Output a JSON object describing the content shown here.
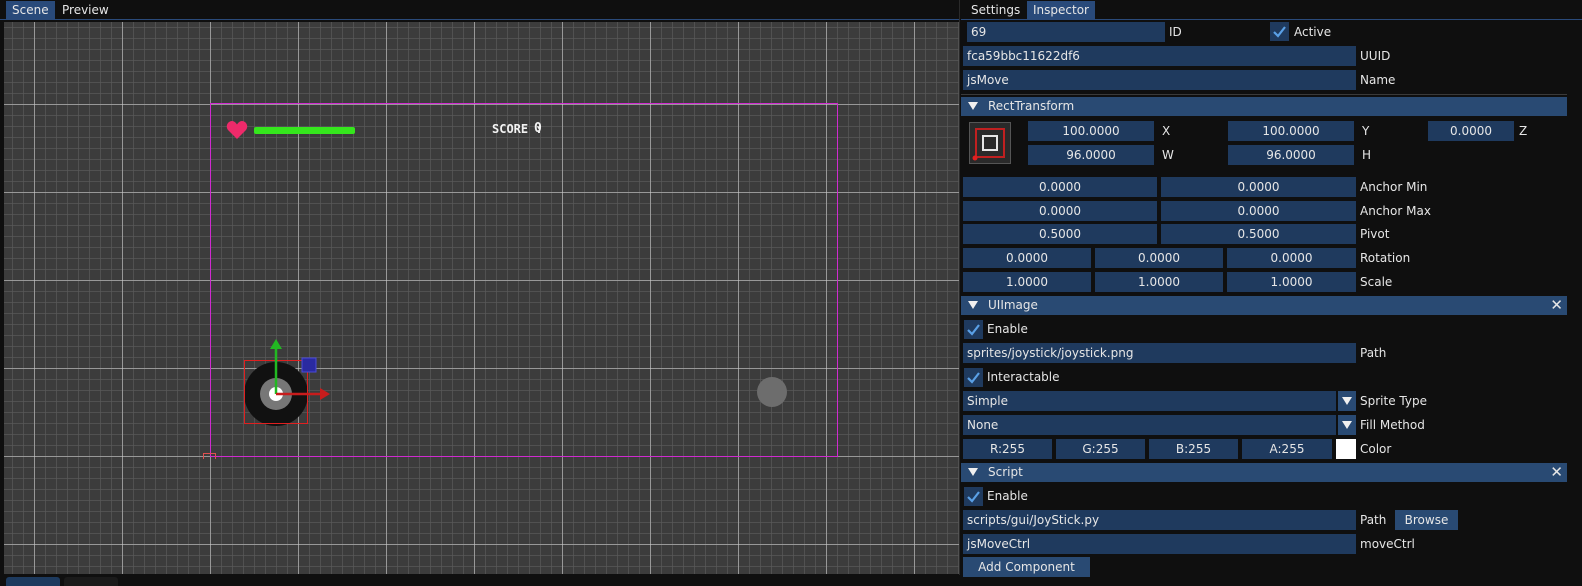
{
  "left": {
    "tabs": [
      {
        "label": "Scene",
        "active": true
      },
      {
        "label": "Preview",
        "active": false
      }
    ],
    "scene": {
      "score_label": "SCORE :",
      "score_value": "0",
      "colors": {
        "canvas_border": "#d02ad0",
        "health": "#35e61d",
        "heart": "#ee2a6a",
        "selection": "#e02020"
      }
    }
  },
  "right": {
    "tabs": [
      {
        "label": "Settings",
        "active": false
      },
      {
        "label": "Inspector",
        "active": true
      }
    ],
    "object": {
      "id_value": "69",
      "id_label": "ID",
      "active_label": "Active",
      "uuid_value": "fca59bbc11622df6",
      "uuid_label": "UUID",
      "name_value": "jsMove",
      "name_label": "Name"
    },
    "rect_transform": {
      "title": "RectTransform",
      "x": "100.0000",
      "x_label": "X",
      "y": "100.0000",
      "y_label": "Y",
      "z": "0.0000",
      "z_label": "Z",
      "w": "96.0000",
      "w_label": "W",
      "h": "96.0000",
      "h_label": "H",
      "anchor_min": [
        "0.0000",
        "0.0000"
      ],
      "anchor_min_label": "Anchor Min",
      "anchor_max": [
        "0.0000",
        "0.0000"
      ],
      "anchor_max_label": "Anchor Max",
      "pivot": [
        "0.5000",
        "0.5000"
      ],
      "pivot_label": "Pivot",
      "rotation": [
        "0.0000",
        "0.0000",
        "0.0000"
      ],
      "rotation_label": "Rotation",
      "scale": [
        "1.0000",
        "1.0000",
        "1.0000"
      ],
      "scale_label": "Scale"
    },
    "ui_image": {
      "title": "UIImage",
      "close": "✕",
      "enable_label": "Enable",
      "path_value": "sprites/joystick/joystick.png",
      "path_label": "Path",
      "interactable_label": "Interactable",
      "sprite_type_value": "Simple",
      "sprite_type_label": "Sprite Type",
      "fill_method_value": "None",
      "fill_method_label": "Fill Method",
      "color_r": "R:255",
      "color_g": "G:255",
      "color_b": "B:255",
      "color_a": "A:255",
      "color_label": "Color",
      "swatch_color": "#ffffff"
    },
    "script": {
      "title": "Script",
      "close": "✕",
      "enable_label": "Enable",
      "path_value": "scripts/gui/JoyStick.py",
      "path_label": "Path",
      "browse_label": "Browse",
      "param_value": "jsMoveCtrl",
      "param_label": "moveCtrl"
    },
    "add_component_label": "Add Component"
  }
}
